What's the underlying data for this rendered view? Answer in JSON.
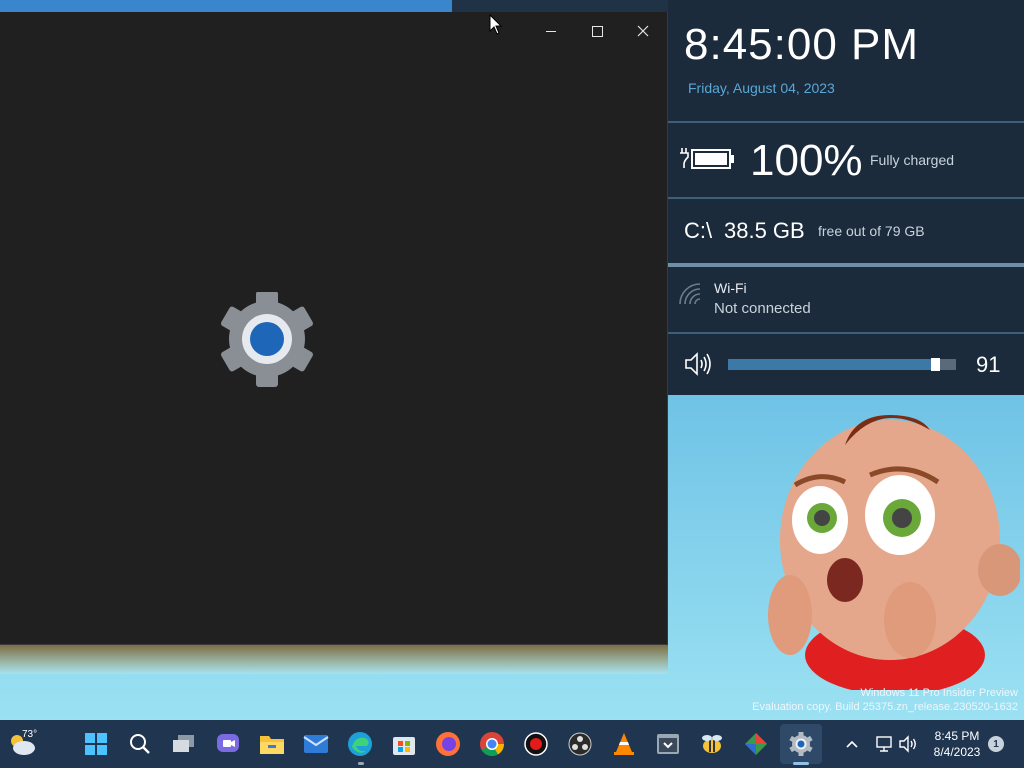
{
  "window": {
    "controls": {
      "minimize": "minimize",
      "maximize": "maximize",
      "close": "close"
    }
  },
  "sysinfo": {
    "time": "8:45:00 PM",
    "date": "Friday, August 04, 2023",
    "battery": {
      "percent_text": "100%",
      "status": "Fully charged"
    },
    "disk": {
      "drive": "C:\\",
      "free": "38.5 GB",
      "total_text": "free out of 79 GB"
    },
    "wifi": {
      "name": "Wi-Fi",
      "status": "Not connected"
    },
    "volume": {
      "value_text": "91",
      "level": 0.91
    }
  },
  "watermark": {
    "line1": "Windows 11 Pro Insider Preview",
    "line2": "Evaluation copy. Build 25375.zn_release.230520-1632"
  },
  "taskbar": {
    "weather_temp": "73°",
    "apps": [
      "weather-widget",
      "start",
      "search",
      "task-view",
      "teams-chat",
      "file-explorer",
      "mail",
      "edge",
      "microsoft-store",
      "firefox",
      "chrome",
      "screen-recorder",
      "obs-studio",
      "vlc",
      "app-gray",
      "bee-app",
      "git-app",
      "settings"
    ],
    "tray": {
      "time": "8:45 PM",
      "date": "8/4/2023",
      "notifications": "1"
    }
  },
  "colors": {
    "accent": "#5aa7d6",
    "panel_bg": "#1b2b3b",
    "window_bg": "#202020",
    "taskbar_bg": "#1f3550"
  }
}
